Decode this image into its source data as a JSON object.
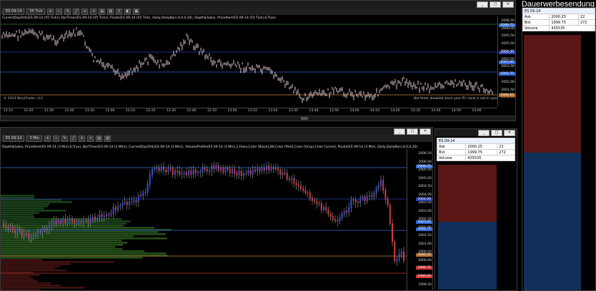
{
  "watermark": "Dauerwerbesendung",
  "top_chart": {
    "instrument": "ES 09-14",
    "timeframe": "55 Tick",
    "indicators": "CurrentDayOHL(ES 09-14 (55 Tick)), BarTimer(ES 09-14 (55 Tick)), Pivots(ES 09-14 (55 Tick), Daily,DailyBars,0,0,0,20), Depth&Sales, PriceAlert(ES 09-14 (55 Tick),0,True)",
    "copyright": "© 2014 NinjaTrader, LLC",
    "note": "Bar timer disabled since your PC clock is not in sync",
    "price_labels": [
      "2006.50",
      "2006.00",
      "2005.50",
      "2005.00",
      "2004.00",
      "2003.50",
      "2003.00",
      "2002.50",
      "2002.00",
      "2001.50",
      "2001.00"
    ],
    "tags": [
      {
        "text": "2006.75",
        "color": "#3d6fd1"
      },
      {
        "text": "2004.00",
        "color": "#2b3fb0"
      },
      {
        "text": "2003.00",
        "color": "#2f64d8"
      },
      {
        "text": "2002.75",
        "color": "#2f64d8"
      },
      {
        "text": "2000.50",
        "color": "#b06a2b"
      }
    ],
    "time_labels": [
      "11:10",
      "11:20",
      "11:30",
      "11:40",
      "11:50",
      "12:00",
      "12:10",
      "12:20",
      "12:30",
      "12:40",
      "12:50",
      "13:00",
      "13:10",
      "13:20",
      "13:30",
      "13:40",
      "13:50",
      "14:00",
      "14:10",
      "14:20",
      "14:30",
      "14:40",
      "14:50",
      "15:00"
    ]
  },
  "bottom_chart": {
    "instrument": "ES 09-14",
    "timeframe": "3 Min",
    "indicators": "Depth&Sales, PriceAlert(ES 09-14 (3 Min),0,True), BarTimer(ES 09-14 (3 Min)), CurrentDayOHL(ES 09-14 (3 Min)), VolumeProfile(ES 09-14 (3 Min),1,False,Color [Black],80,Color [Red],Color [Gray],Color [Lime]), Pivots(ES 09-14 (3 Min), Daily,DailyBars,0,0,0,20)",
    "price_labels": [
      "2006.50",
      "2006.00",
      "2005.50",
      "2005.00",
      "2004.50",
      "2004.00",
      "2003.50",
      "2003.00",
      "2002.50",
      "2002.00",
      "2001.50",
      "2001.00",
      "2000.50",
      "2000.00",
      "1999.50",
      "1999.00",
      "1998.50"
    ],
    "tags": [
      {
        "text": "2006.75",
        "color": "#3d6fd1"
      },
      {
        "text": "2004.00",
        "color": "#2b3fb0"
      },
      {
        "text": "2003.00",
        "color": "#2f64d8"
      },
      {
        "text": "2002.75",
        "color": "#2f64d8"
      },
      {
        "text": "2000.50",
        "color": "#b06a2b"
      },
      {
        "text": "1999.75",
        "color": "#c33"
      },
      {
        "text": "1999.00",
        "color": "#c33"
      }
    ]
  },
  "dom_top": {
    "title": "ES 09-14",
    "ask_label": "Ask",
    "ask_price": "2000.25",
    "ask_size": "22",
    "bid_label": "Bid",
    "bid_price": "1999.75",
    "bid_size": "272",
    "volume_label": "Volume",
    "volume": "435535"
  },
  "dom_bottom": {
    "title": "ES 09-14",
    "ask_label": "Ask",
    "ask_price": "2000.25",
    "ask_size": "22",
    "bid_label": "Bid",
    "bid_price": "1999.75",
    "bid_size": "272",
    "volume_label": "Volume",
    "volume": "435535"
  },
  "colors": {
    "up_bar": "#3b4bd8",
    "down_bar": "#d23b3b",
    "tick_bar": "#e0c8d6",
    "pivot_line": "#c8873a",
    "ask_row": "#5a1515",
    "bid_row": "#10305a"
  }
}
